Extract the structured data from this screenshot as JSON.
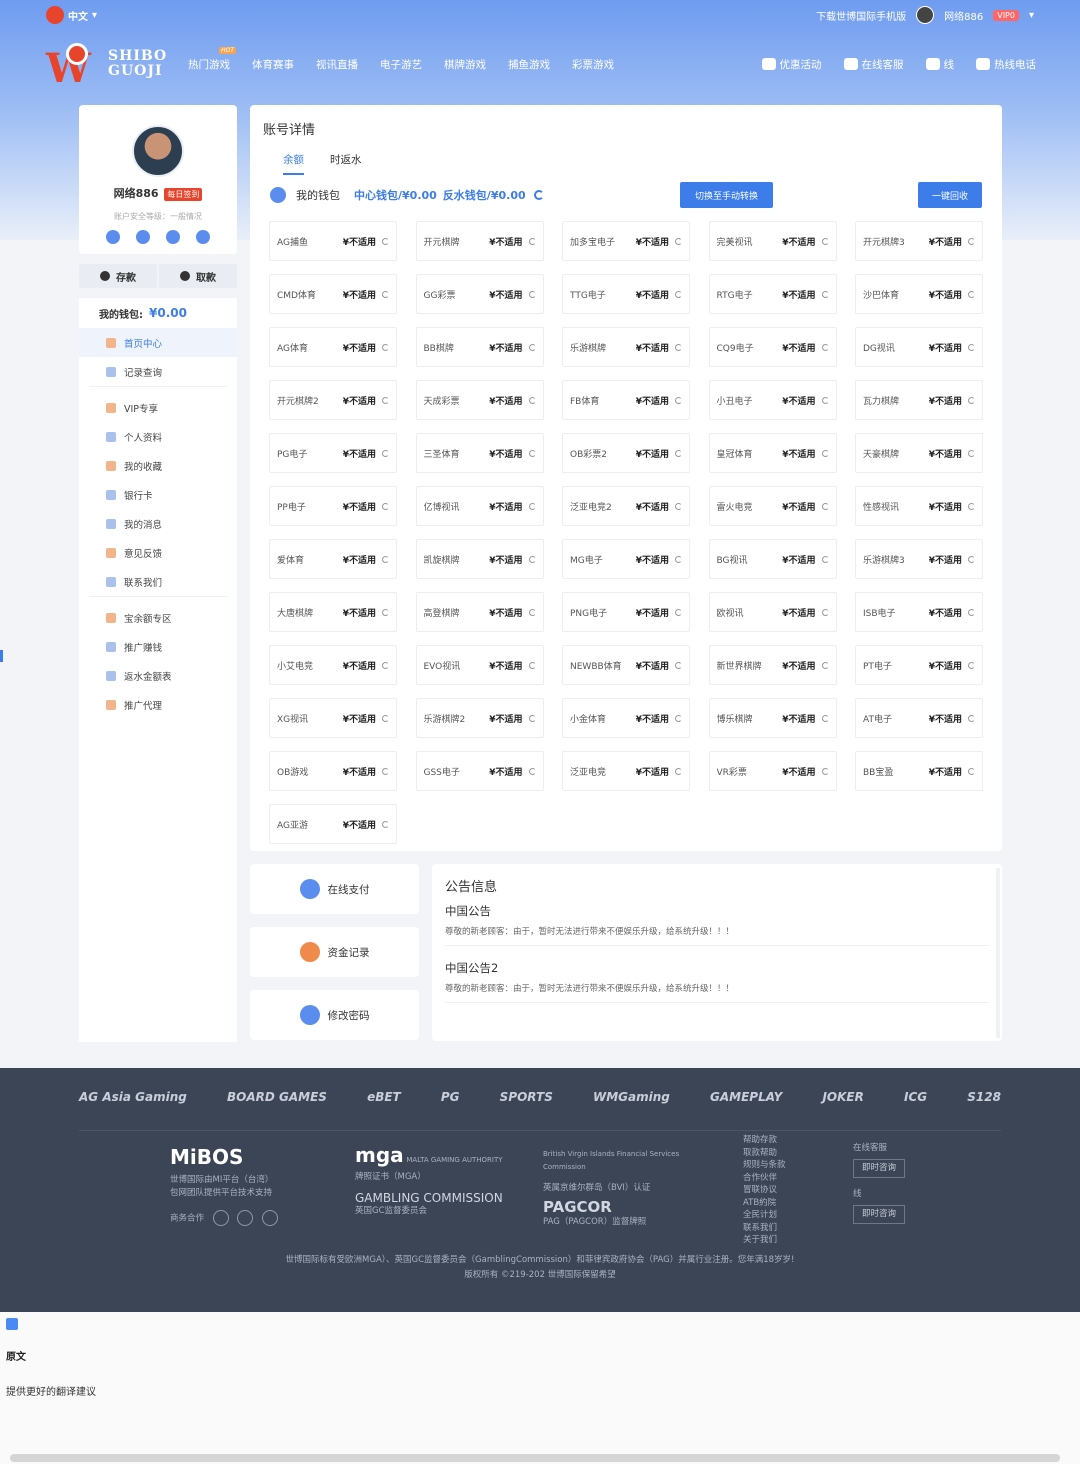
{
  "topbar": {
    "language": "中文",
    "download": "下载世博国际手机版",
    "username": "网络886",
    "vip": "VIP0"
  },
  "nav": {
    "logo_line1": "SHIBO",
    "logo_line2": "GUOJI",
    "hot_badge": "HOT",
    "items": [
      "热门游戏",
      "体育赛事",
      "视讯直播",
      "电子游艺",
      "棋牌游戏",
      "捕鱼游戏",
      "彩票游戏"
    ],
    "right": [
      "优惠活动",
      "在线客服",
      "线",
      "热线电话"
    ]
  },
  "profile": {
    "name": "网络886",
    "sign_badge": "每日签到",
    "security": "账户安全等级：一般情况",
    "deposit": "存款",
    "withdraw": "取款"
  },
  "menu": {
    "wallet_label": "我的钱包:",
    "wallet_value": "¥0.00",
    "items": [
      "首页中心",
      "记录查询",
      "VIP专享",
      "个人资料",
      "我的收藏",
      "银行卡",
      "我的消息",
      "意见反馈",
      "联系我们",
      "宝余额专区",
      "推广赚钱",
      "返水金额表",
      "推广代理"
    ]
  },
  "main": {
    "title": "账号详情",
    "tab_balance": "余额",
    "tab_rebate": "时返水",
    "wallet_label": "我的钱包",
    "center_wallet": "中心钱包/¥0.00",
    "rebate_wallet": "反水钱包/¥0.00",
    "switch_btn": "切换至手动转换",
    "recover_btn": "一键回收",
    "status": "¥不适用",
    "games": [
      "AG捕鱼",
      "开元棋牌",
      "加多宝电子",
      "完美视讯",
      "开元棋牌3",
      "CMD体育",
      "GG彩票",
      "TTG电子",
      "RTG电子",
      "沙巴体育",
      "AG体育",
      "BB棋牌",
      "乐游棋牌",
      "CQ9电子",
      "DG视讯",
      "开元棋牌2",
      "天成彩票",
      "FB体育",
      "小丑电子",
      "瓦力棋牌",
      "PG电子",
      "三圣体育",
      "OB彩票2",
      "皇冠体育",
      "天豪棋牌",
      "PP电子",
      "亿博视讯",
      "泛亚电竞2",
      "雷火电竞",
      "性感视讯",
      "爱体育",
      "凯旋棋牌",
      "MG电子",
      "BG视讯",
      "乐游棋牌3",
      "大唐棋牌",
      "高登棋牌",
      "PNG电子",
      "欧视讯",
      "ISB电子",
      "小艾电竞",
      "EVO视讯",
      "NEWBB体育",
      "新世界棋牌",
      "PT电子",
      "XG视讯",
      "乐游棋牌2",
      "小金体育",
      "博乐棋牌",
      "AT电子",
      "OB游戏",
      "GSS电子",
      "泛亚电竞",
      "VR彩票",
      "BB宝盈",
      "AG亚游"
    ]
  },
  "quick_links": [
    "在线支付",
    "资金记录",
    "修改密码"
  ],
  "notice": {
    "title": "公告信息",
    "items": [
      {
        "title": "中国公告",
        "body": "尊敬的新老顾客：由于，暂时无法进行带来不便娱乐升级，给系统升级！！！"
      },
      {
        "title": "中国公告2",
        "body": "尊敬的新老顾客：由于，暂时无法进行带来不便娱乐升级，给系统升级！！！"
      }
    ]
  },
  "footer": {
    "partners": [
      "AG Asia Gaming",
      "BOARD GAMES",
      "eBET",
      "PG",
      "SPORTS",
      "WMGaming",
      "GAMEPLAY",
      "JOKER",
      "ICG",
      "S128"
    ],
    "mibos_logo": "MiBOS",
    "mibos_lines": [
      "世博国际由MI平台（台湾）",
      "包网团队提供平台技术支持"
    ],
    "business": "商务合作",
    "mga_logo": "mga",
    "mga_sub": "MALTA GAMING AUTHORITY",
    "mga_cert": "牌照证书（MGA）",
    "gc_logo": "GAMBLING COMMISSION",
    "gc_cert": "英国GC监督委员会",
    "bvi_sub": "British Virgin Islands Financial Services Commission",
    "bvi_cert": "英属京维尔群岛（BVI）认证",
    "pagcor_logo": "PAGCOR",
    "pagcor_cert": "PAG（PAGCOR）监督牌照",
    "help_links": [
      "帮助存款",
      "取款帮助",
      "规则与条款",
      "合作伙伴",
      "冒联协议",
      "ATB約院",
      "全民计划",
      "联系我们",
      "关于我们"
    ],
    "service_label": "在线客服",
    "service_btn": "即时咨询",
    "line_label": "线",
    "line_btn": "即时咨询",
    "copyright_1": "世博国际标有受欧洲MGA）、英国GC监督委员会（GamblingCommission）和菲律宾政府协会（PAG）并属行业注册。您年满18岁岁!",
    "copyright_2": "版权所有 ©219-202 世博国际保留希望"
  },
  "translate": {
    "original": "原文",
    "suggest": "提供更好的翻译建议"
  }
}
